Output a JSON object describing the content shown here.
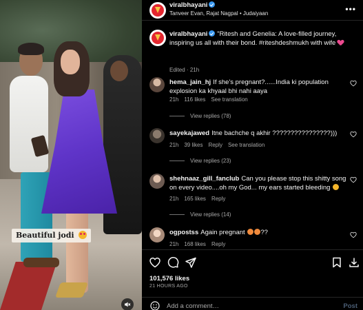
{
  "media": {
    "sticker_text": "Beautiful jodi",
    "sticker_emoji_icon": "heart-eyes-emoji",
    "audio_icon": "speaker-muted-icon"
  },
  "header": {
    "username": "viralbhayani",
    "verified": true,
    "subtitle": "Tanveer Evan, Rajat Nagpal • Judaiyaan",
    "more_label": "•••"
  },
  "caption": {
    "username": "viralbhayani",
    "text": "\"Ritesh and Genelia: A love-filled journey, inspiring us all with their bond. #riteshdeshmukh with wife",
    "emoji": "pink-heart-emoji",
    "edited": "Edited",
    "dot": "·",
    "time": "21h"
  },
  "comments": [
    {
      "username": "hema_jain_hj",
      "text": "If she's pregnant?......India ki population explosion ka khyaal bhi nahi aaya",
      "time": "21h",
      "likes": "116 likes",
      "reply": "See translation",
      "replies": "View replies (78)"
    },
    {
      "username": "sayekajawed",
      "text": "Itne bachche q akhir ????????????????)))",
      "time": "21h",
      "likes": "39 likes",
      "reply": "Reply",
      "translate": "See translation",
      "replies": "View replies (23)"
    },
    {
      "username": "shehnaaz_gill_fanclub",
      "text": "Can you please stop this shitty song on every video....oh my God... my ears started bleeding",
      "time": "21h",
      "likes": "165 likes",
      "reply": "Reply",
      "replies": "View replies (14)"
    },
    {
      "username": "ogpostss",
      "text": "Again pregnant",
      "tail": "??",
      "time": "21h",
      "likes": "168 likes",
      "reply": "Reply"
    }
  ],
  "actions": {
    "likes": "101,576 likes",
    "time_ago": "21 HOURS AGO",
    "add_comment_placeholder": "Add a comment…",
    "post_label": "Post"
  }
}
